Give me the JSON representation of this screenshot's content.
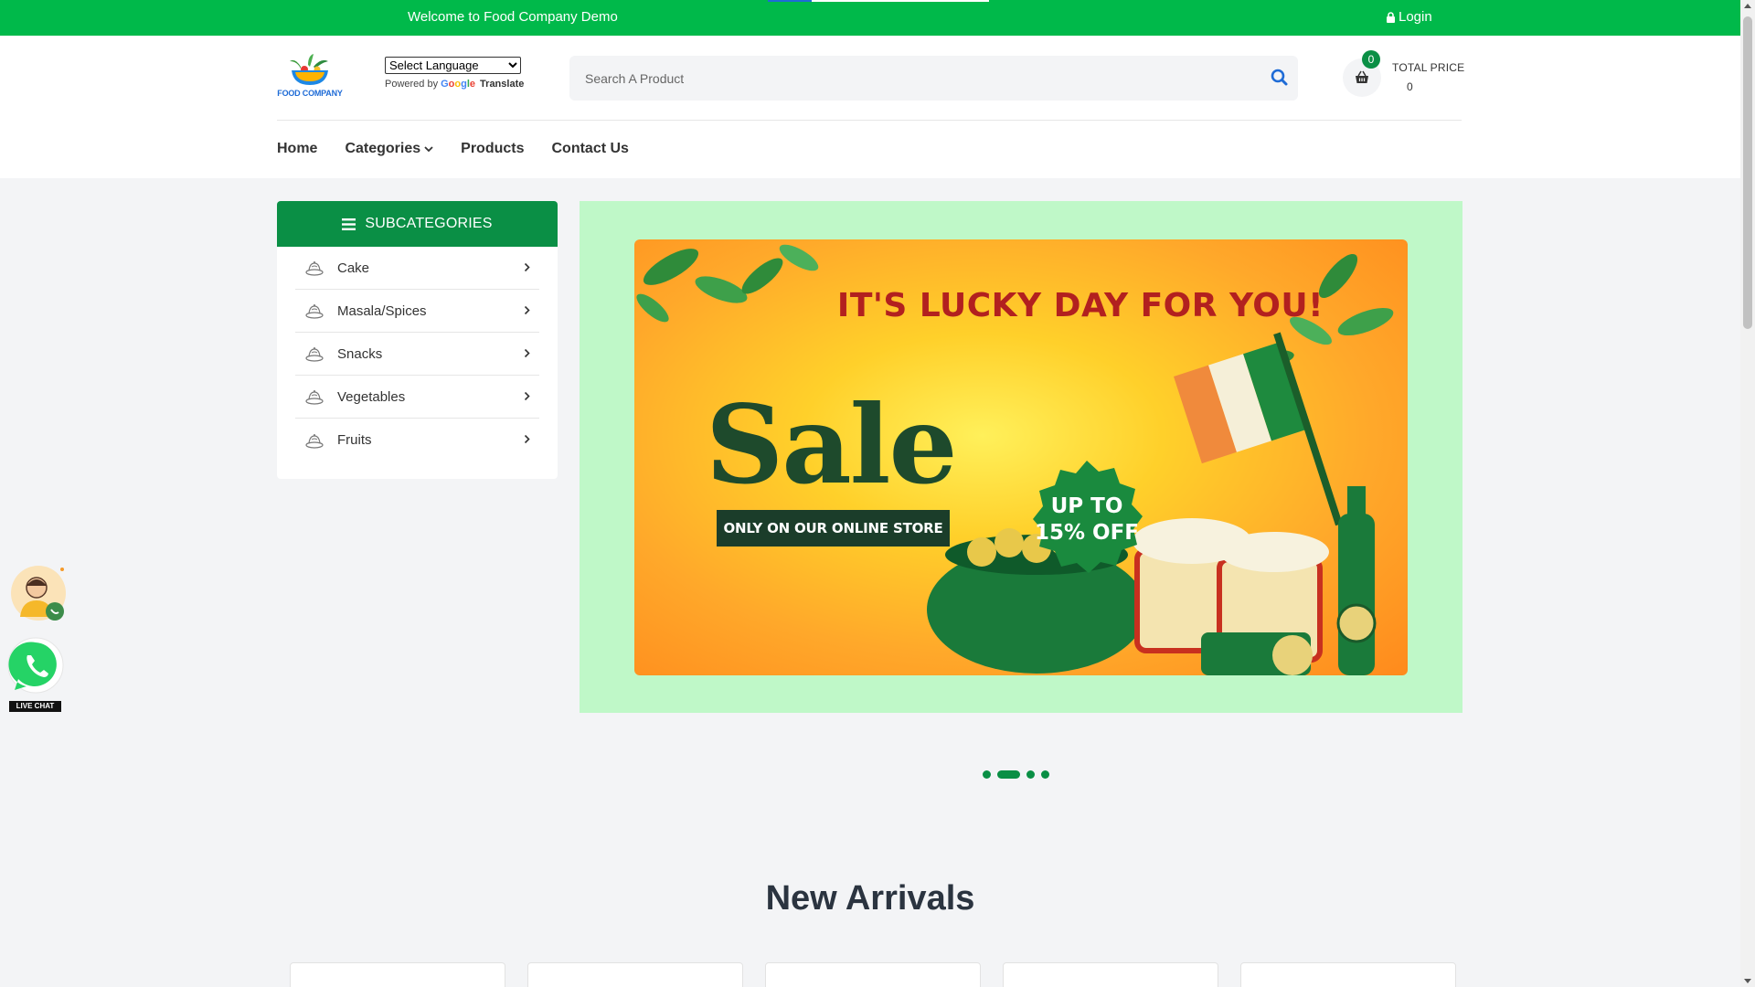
{
  "topbar": {
    "welcome": "Welcome to Food Company Demo",
    "login": "Login",
    "lock_icon": "lock-icon"
  },
  "header": {
    "logo_text": "FOOD COMPANY",
    "language": {
      "selected": "Select Language",
      "powered_by": "Powered by",
      "google": "Google",
      "translate": "Translate"
    },
    "search": {
      "placeholder": "Search A Product",
      "icon": "search-icon"
    },
    "cart": {
      "count": "0",
      "icon": "basket-icon"
    },
    "total": {
      "label": "TOTAL PRICE",
      "value": "0"
    }
  },
  "nav": {
    "home": "Home",
    "categories": "Categories",
    "products": "Products",
    "contact": "Contact Us"
  },
  "subcategories": {
    "title": "SUBCATEGORIES",
    "items": [
      {
        "label": "Cake"
      },
      {
        "label": "Masala/Spices"
      },
      {
        "label": "Snacks"
      },
      {
        "label": "Vegetables"
      },
      {
        "label": "Fruits"
      }
    ]
  },
  "banner": {
    "headline": "IT'S LUCKY DAY FOR YOU!",
    "sale": "Sale",
    "store_button": "ONLY ON OUR ONLINE STORE",
    "offer_line1": "UP TO",
    "offer_line2": "15% OFF",
    "slides": 4,
    "active_slide": 2
  },
  "section": {
    "title": "New Arrivals"
  },
  "floating": {
    "live_chat": "LIVE CHAT"
  },
  "colors": {
    "brand_green": "#00b94a",
    "dark_green": "#0a8f45",
    "banner_bg": "#bff8c8",
    "headline_red": "#b2201f"
  }
}
